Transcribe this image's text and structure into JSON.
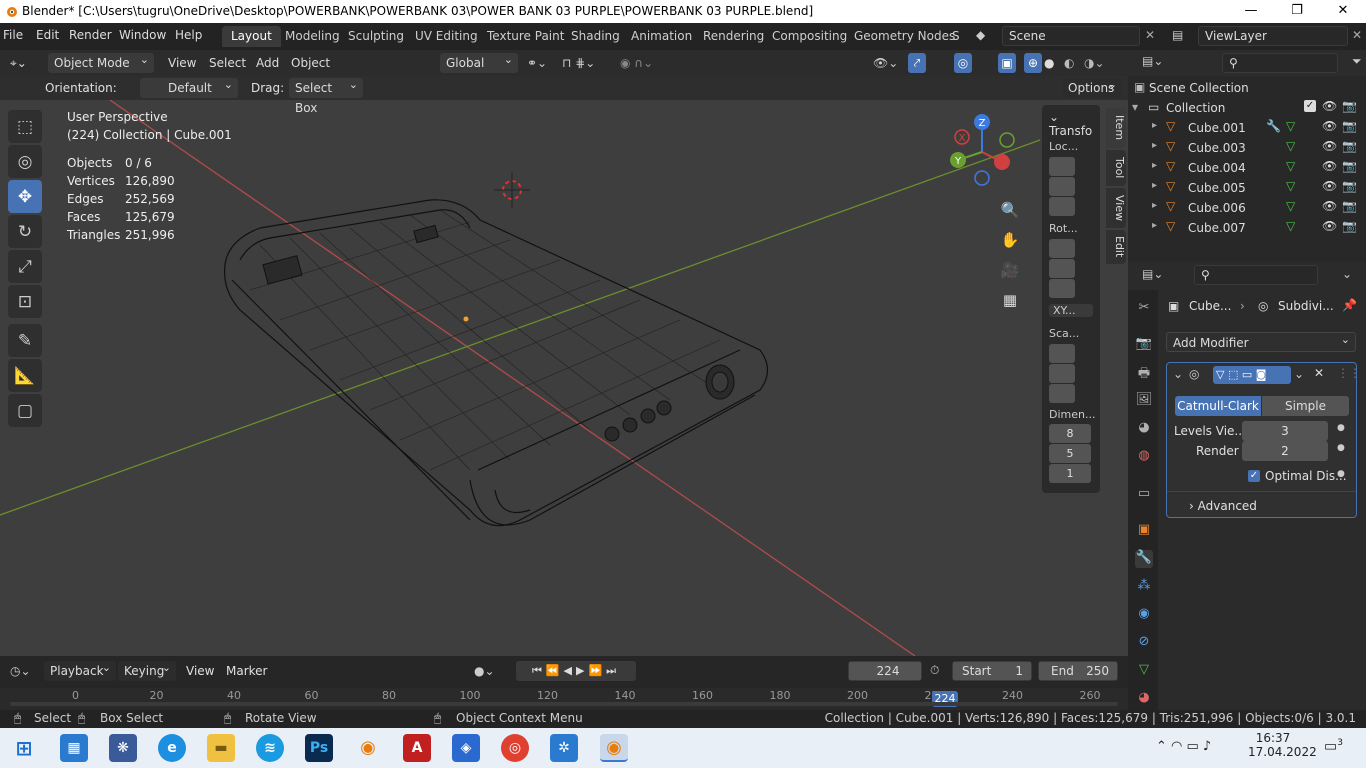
{
  "window": {
    "title": "Blender* [C:\\Users\\tugru\\OneDrive\\Desktop\\POWERBANK\\POWERBANK 03\\POWER BANK 03 PURPLE\\POWERBANK 03 PURPLE.blend]",
    "minimize": "—",
    "maximize": "❐",
    "close": "✕"
  },
  "menu": [
    "File",
    "Edit",
    "Render",
    "Window",
    "Help"
  ],
  "workspaces": [
    "Layout",
    "Modeling",
    "Sculpting",
    "UV Editing",
    "Texture Paint",
    "Shading",
    "Animation",
    "Rendering",
    "Compositing",
    "Geometry Nodes",
    "S"
  ],
  "scene": {
    "scene_name": "Scene",
    "view_layer": "ViewLayer"
  },
  "viewport_header": {
    "mode": "Object Mode",
    "view": "View",
    "select": "Select",
    "add": "Add",
    "object": "Object",
    "transform": "Global",
    "options": "Options"
  },
  "viewport_header2": {
    "orientation_label": "Orientation:",
    "orientation_value": "Default",
    "drag_label": "Drag:",
    "drag_value": "Select Box"
  },
  "overlay": {
    "perspective": "User Perspective",
    "collection": "(224) Collection | Cube.001"
  },
  "stats": [
    {
      "label": "Objects",
      "value": "0 / 6"
    },
    {
      "label": "Vertices",
      "value": "126,890"
    },
    {
      "label": "Edges",
      "value": "252,569"
    },
    {
      "label": "Faces",
      "value": "125,679"
    },
    {
      "label": "Triangles",
      "value": "251,996"
    }
  ],
  "npanel": {
    "title": "Transfo",
    "loc": "Loc...",
    "rot": "Rot...",
    "rotmode": "XY...",
    "scale": "Sca...",
    "dimen": "Dimen...",
    "dim_values": [
      "8",
      "5",
      "1"
    ],
    "tabs": [
      "Item",
      "Tool",
      "View",
      "Edit"
    ]
  },
  "gizmo": {
    "x": "X",
    "y": "Y",
    "z": "Z"
  },
  "outliner": {
    "root": "Scene Collection",
    "collection": "Collection",
    "items": [
      "Cube.001",
      "Cube.003",
      "Cube.004",
      "Cube.005",
      "Cube.006",
      "Cube.007"
    ]
  },
  "properties": {
    "breadcrumb_obj": "Cube...",
    "breadcrumb_mod": "Subdivi...",
    "add_modifier": "Add Modifier",
    "catmull": "Catmull-Clark",
    "simple": "Simple",
    "levels_label": "Levels Vie...",
    "levels_value": "3",
    "render_label": "Render",
    "render_value": "2",
    "optimal": "Optimal Dis...",
    "advanced": "Advanced"
  },
  "timeline": {
    "playback": "Playback",
    "keying": "Keying",
    "view": "View",
    "marker": "Marker",
    "frame": "224",
    "start_label": "Start",
    "start": "1",
    "end_label": "End",
    "end": "250",
    "ticks": [
      "0",
      "20",
      "40",
      "60",
      "80",
      "100",
      "120",
      "140",
      "160",
      "180",
      "200",
      "220",
      "240",
      "260"
    ],
    "current": "224"
  },
  "status": {
    "select": "Select",
    "box_select": "Box Select",
    "rotate": "Rotate View",
    "context": "Object Context Menu",
    "info": "Collection | Cube.001 | Verts:126,890 | Faces:125,679 | Tris:251,996 | Objects:0/6 | 3.0.1"
  },
  "clock": {
    "time": "16:37",
    "date": "17.04.2022",
    "notifications": "3"
  }
}
